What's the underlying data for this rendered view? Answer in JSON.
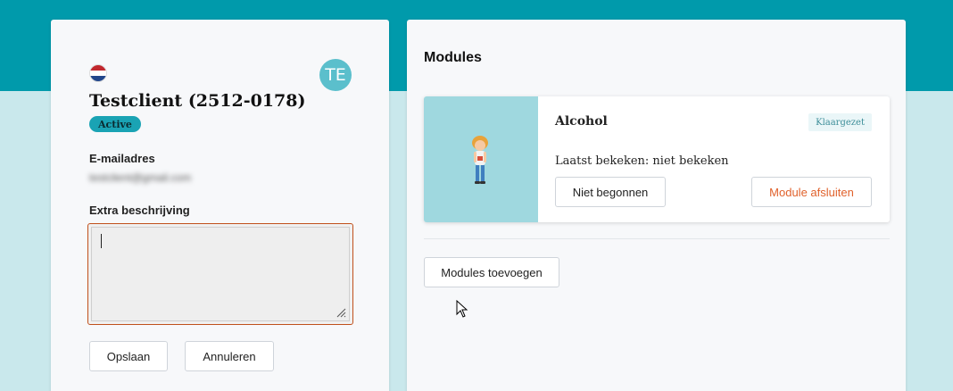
{
  "colors": {
    "brand_teal": "#009aab",
    "background_light": "#c9e8ec",
    "avatar_bg": "#5bbfcc",
    "badge_bg": "#1aa3b4",
    "accent_orange": "#e0612b",
    "textarea_border": "#c0501c"
  },
  "client": {
    "flag_icon": "netherlands-flag-icon",
    "avatar_initials": "TE",
    "name": "Testclient (2512-0178)",
    "status": "Active",
    "email_label": "E-mailadres",
    "email_value": "testclient@gmail.com",
    "description_label": "Extra beschrijving",
    "description_value": "",
    "save_label": "Opslaan",
    "cancel_label": "Annuleren"
  },
  "modules": {
    "title": "Modules",
    "items": [
      {
        "title": "Alcohol",
        "status": "Klaargezet",
        "last_viewed": "Laatst bekeken: niet bekeken",
        "progress_label": "Niet begonnen",
        "close_label": "Module afsluiten",
        "image_icon": "person-illustration-icon"
      }
    ],
    "add_label": "Modules toevoegen"
  }
}
